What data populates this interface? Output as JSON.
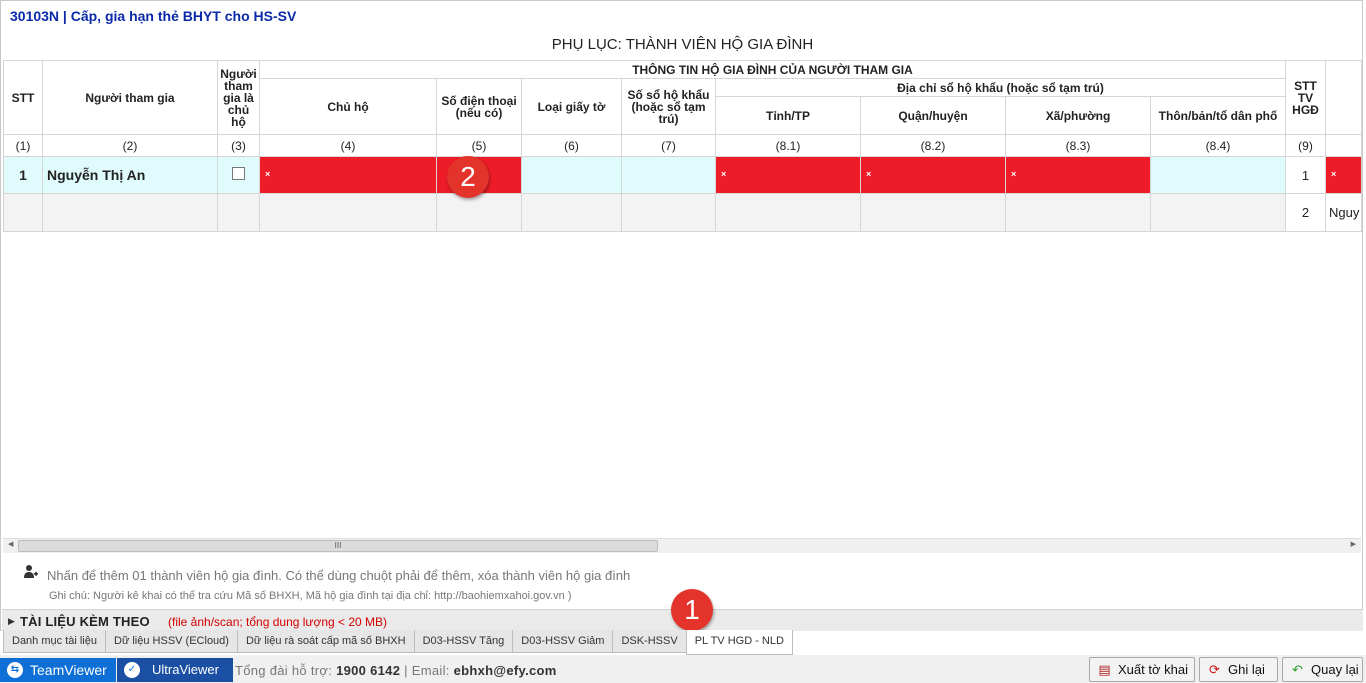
{
  "window": {
    "title": "30103N | Cấp, gia hạn thẻ BHYT cho HS-SV",
    "heading": "PHỤ LỤC: THÀNH VIÊN HỘ GIA ĐÌNH"
  },
  "table": {
    "group_header": "THÔNG TIN HỘ GIA ĐÌNH CỦA NGƯỜI THAM GIA",
    "address_header": "Địa chỉ sổ hộ khẩu (hoặc sổ tạm trú)",
    "columns": {
      "stt": "STT",
      "participant": "Người tham gia",
      "is_head": "Người tham gia là chủ hộ",
      "head": "Chủ hộ",
      "phone": "Số điện thoại (nếu có)",
      "doc_type": "Loại giấy tờ",
      "book_no": "Số sổ hộ khẩu (hoặc sổ tạm trú)",
      "province": "Tỉnh/TP",
      "district": "Quận/huyện",
      "ward": "Xã/phường",
      "village": "Thôn/bản/tổ dân phố",
      "stt_member": "STT TV HGĐ"
    },
    "numbers": [
      "(1)",
      "(2)",
      "(3)",
      "(4)",
      "(5)",
      "(6)",
      "(7)",
      "(8.1)",
      "(8.2)",
      "(8.3)",
      "(8.4)",
      "(9)"
    ],
    "rows": [
      {
        "stt": "1",
        "name": "Nguyễn Thị An",
        "member_stt": "1"
      },
      {
        "stt": "",
        "name": "",
        "member_stt": "2",
        "overflow": "Nguy"
      }
    ],
    "error_mark": "×"
  },
  "annotations": {
    "badge_1": "1",
    "badge_2": "2"
  },
  "scroll_grip": "III",
  "add_member_text": "Nhấn để thêm 01 thành viên hộ gia đình. Có thể dùng chuột phải để thêm, xóa thành viên hộ gia đình",
  "note": "Ghi chú: Người kê khai có thể tra cứu Mã số BHXH, Mã hộ gia đình tại địa chỉ: http://baohiemxahoi.gov.vn )",
  "attachments": {
    "label": "TÀI LIỆU KÈM THEO",
    "sub": "(file ảnh/scan; tổng dung lượng < 20 MB)"
  },
  "tabs": [
    "Danh mục tài liệu",
    "Dữ liệu HSSV (ECloud)",
    "Dữ liệu rà soát cấp mã số BHXH",
    "D03-HSSV Tăng",
    "D03-HSSV Giảm",
    "DSK-HSSV",
    "PL TV HGD - NLD"
  ],
  "active_tab": "PL TV HGD - NLD",
  "status": {
    "teamviewer": "TeamViewer",
    "ultraviewer": "UltraViewer",
    "hotline_label": "Tổng đài hỗ trợ:",
    "hotline": "1900 6142",
    "email_label": "Email:",
    "email": "ebhxh@efy.com"
  },
  "buttons": {
    "export": "Xuất tờ khai",
    "save": "Ghi lại",
    "back": "Quay lại"
  },
  "colors": {
    "title": "#0b2aa8",
    "error": "#ee1b28",
    "row": "#e0fbfb",
    "badge": "#e3332b"
  }
}
